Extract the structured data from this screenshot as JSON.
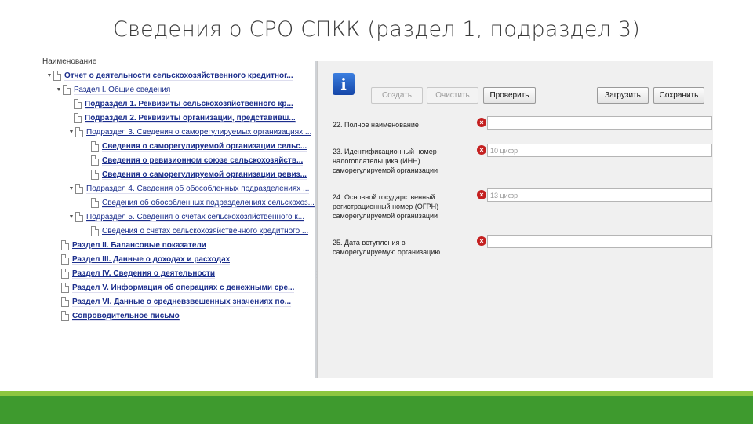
{
  "slide_title": "Сведения о СРО СПКК (раздел 1, подраздел 3)",
  "tree": {
    "header": "Наименование",
    "items": [
      {
        "label": "Отчет о деятельности сельскохозяйственного кредитног...",
        "expander": "▼",
        "bold": true
      },
      {
        "label": "Раздел I. Общие сведения",
        "expander": "▼",
        "bold": false
      },
      {
        "label": "Подраздел 1. Реквизиты сельскохозяйственного кр...",
        "expander": "",
        "bold": true
      },
      {
        "label": "Подраздел 2. Реквизиты организации, представивш...",
        "expander": "",
        "bold": true
      },
      {
        "label": "Подраздел 3. Сведения о саморегулируемых организациях ...",
        "expander": "▼",
        "bold": false
      },
      {
        "label": "Сведения о саморегулируемой организации сельс...",
        "expander": "",
        "bold": true
      },
      {
        "label": "Сведения о ревизионном союзе сельскохозяйств...",
        "expander": "",
        "bold": true
      },
      {
        "label": "Сведения о саморегулируемой организации ревиз...",
        "expander": "",
        "bold": true
      },
      {
        "label": "Подраздел 4. Сведения об обособленных подразделениях ...",
        "expander": "▼",
        "bold": false
      },
      {
        "label": "Сведения об обособленных подразделениях сельскохоз...",
        "expander": "",
        "bold": false
      },
      {
        "label": "Подраздел 5. Сведения о счетах сельскохозяйственного к...",
        "expander": "▼",
        "bold": false
      },
      {
        "label": "Сведения о счетах сельскохозяйственного кредитного ...",
        "expander": "",
        "bold": false
      },
      {
        "label": "Раздел II. Балансовые показатели",
        "expander": "",
        "bold": true
      },
      {
        "label": "Раздел III. Данные о доходах и расходах",
        "expander": "",
        "bold": true
      },
      {
        "label": "Раздел IV. Сведения о деятельности",
        "expander": "",
        "bold": true
      },
      {
        "label": "Раздел V. Информация об операциях с денежными сре...",
        "expander": "",
        "bold": true
      },
      {
        "label": "Раздел VI. Данные о средневзвешенных значениях по...",
        "expander": "",
        "bold": true
      },
      {
        "label": "Сопроводительное письмо",
        "expander": "",
        "bold": true
      }
    ]
  },
  "toolbar": {
    "info_glyph": "i",
    "create": "Создать",
    "clear": "Очистить",
    "check": "Проверить",
    "load": "Загрузить",
    "save": "Сохранить"
  },
  "form": {
    "fields": [
      {
        "label": "22. Полное наименование",
        "value": ""
      },
      {
        "label": "23. Идентификационный номер налогоплательщика (ИНН) саморегулируемой организации",
        "value": "10 цифр"
      },
      {
        "label": "24. Основной государственный регистрационный номер (ОГРН) саморегулируемой организации",
        "value": "13 цифр"
      },
      {
        "label": "25. Дата вступления в саморегулируемую организацию",
        "value": ""
      }
    ],
    "error_glyph": "×"
  },
  "colors": {
    "link": "#1b2e8c",
    "error": "#c42020",
    "footer_light": "#8cc63f",
    "footer_dark": "#3e9a2e"
  }
}
